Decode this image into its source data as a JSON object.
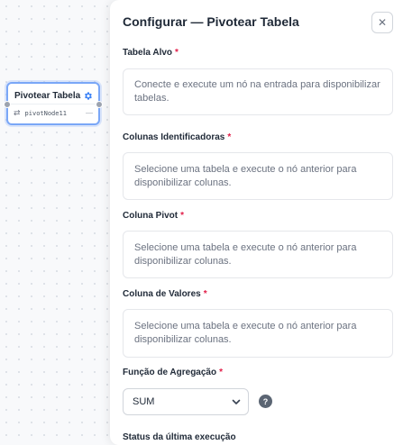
{
  "node": {
    "title": "Pivotear Tabela",
    "id": "pivotNode11",
    "status": "—",
    "swap_symbol": "⇄",
    "icons": [
      "gear-icon",
      "swap-arrows-icon"
    ]
  },
  "panel": {
    "title": "Configurar — Pivotear Tabela",
    "close_symbol": "✕",
    "required_mark": "*",
    "fields": {
      "target_table": {
        "label": "Tabela Alvo",
        "message": "Conecte e execute um nó na entrada para disponibilizar tabelas."
      },
      "id_columns": {
        "label": "Colunas Identificadoras",
        "message": "Selecione uma tabela e execute o nó anterior para disponibilizar colunas."
      },
      "pivot_column": {
        "label": "Coluna Pivot",
        "message": "Selecione uma tabela e execute o nó anterior para disponibilizar colunas."
      },
      "value_column": {
        "label": "Coluna de Valores",
        "message": "Selecione uma tabela e execute o nó anterior para disponibilizar colunas."
      },
      "aggregation": {
        "label": "Função de Agregação",
        "selected": "SUM",
        "help_symbol": "?"
      }
    },
    "cut_off_label": "Status da última execução"
  },
  "colors": {
    "accent": "#7aa7f7",
    "required": "#e11d48",
    "gear": "#3b82f6"
  }
}
